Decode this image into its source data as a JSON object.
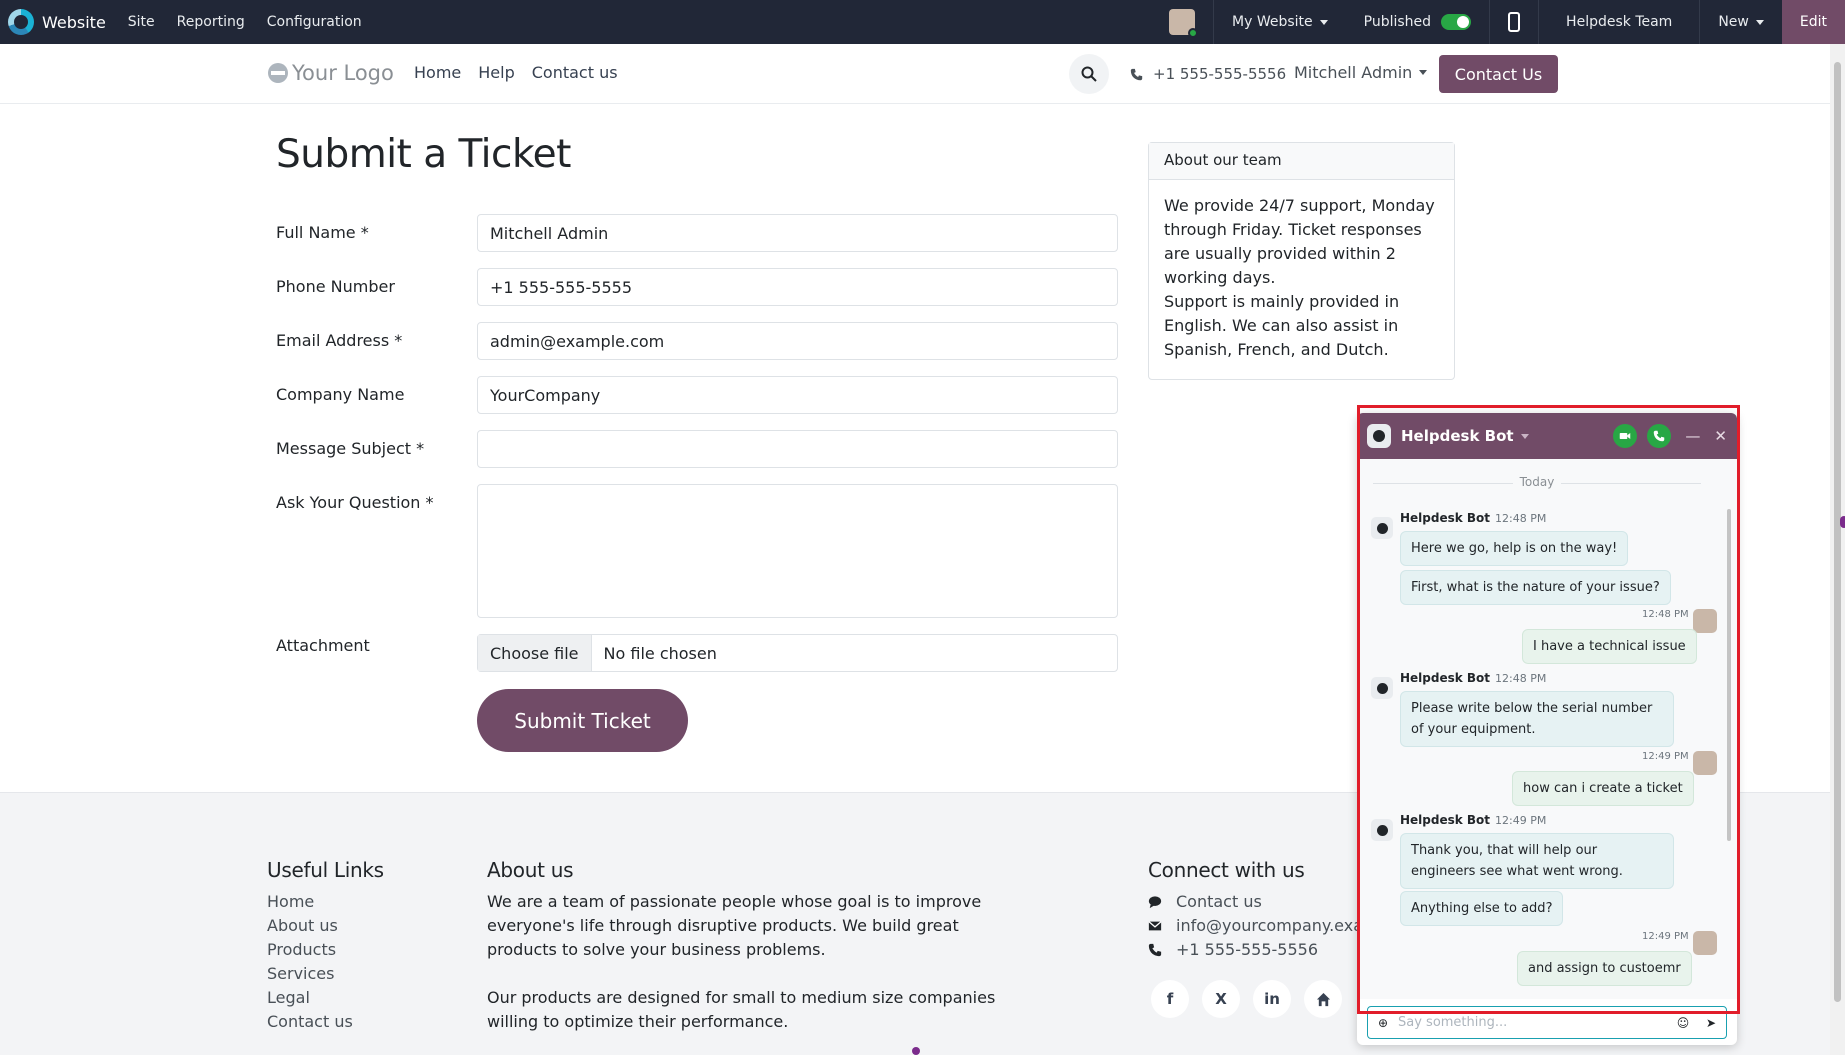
{
  "admin_bar": {
    "app": "Website",
    "menus": [
      "Site",
      "Reporting",
      "Configuration"
    ],
    "my_website": "My Website",
    "published": "Published",
    "team": "Helpdesk Team",
    "new": "New",
    "edit": "Edit"
  },
  "header": {
    "logo": "Your Logo",
    "nav": [
      "Home",
      "Help",
      "Contact us"
    ],
    "phone": "+1 555-555-5556",
    "user": "Mitchell Admin",
    "contact_btn": "Contact Us"
  },
  "form": {
    "title": "Submit a Ticket",
    "full_name_label": "Full Name *",
    "full_name_value": "Mitchell Admin",
    "phone_label": "Phone Number",
    "phone_value": "+1 555-555-5555",
    "email_label": "Email Address *",
    "email_value": "admin@example.com",
    "company_label": "Company Name",
    "company_value": "YourCompany",
    "subject_label": "Message Subject *",
    "subject_value": "",
    "question_label": "Ask Your Question *",
    "attachment_label": "Attachment",
    "choose_file": "Choose file",
    "no_file": "No file chosen",
    "submit": "Submit Ticket"
  },
  "about_card": {
    "title": "About our team",
    "body_1": "We provide 24/7 support, Monday through Friday. Ticket responses are usually provided within 2 working days.",
    "body_2": "Support is mainly provided in English. We can also assist in Spanish, French, and Dutch."
  },
  "footer": {
    "useful_links_title": "Useful Links",
    "links": [
      "Home",
      "About us",
      "Products",
      "Services",
      "Legal",
      "Contact us"
    ],
    "about_title": "About us",
    "about_p1": "We are a team of passionate people whose goal is to improve everyone's life through disruptive products. We build great products to solve your business problems.",
    "about_p2": "Our products are designed for small to medium size companies willing to optimize their performance.",
    "connect_title": "Connect with us",
    "connect_contact": "Contact us",
    "connect_email": "info@yourcompany.exa",
    "connect_phone": "+1 555-555-5556",
    "socials": [
      "f",
      "X",
      "in",
      "home-icon"
    ]
  },
  "chat": {
    "title": "Helpdesk Bot",
    "today": "Today",
    "bot_name": "Helpdesk Bot",
    "t1248": "12:48 PM",
    "t1249": "12:49 PM",
    "m1": "Here we go, help is on the way!",
    "m2": "First, what is the nature of your issue?",
    "u1": "I have a technical issue",
    "m3": "Please write below the serial number of your equipment.",
    "u2": "how can i create a ticket",
    "m4": "Thank you, that will help our engineers see what went wrong.",
    "m5": "Anything else to add?",
    "u3": "and assign to custoemr",
    "input_placeholder": "Say something..."
  },
  "colors": {
    "brand": "#714b67",
    "admin_bar": "#212737",
    "highlight": "#e11d2a"
  }
}
